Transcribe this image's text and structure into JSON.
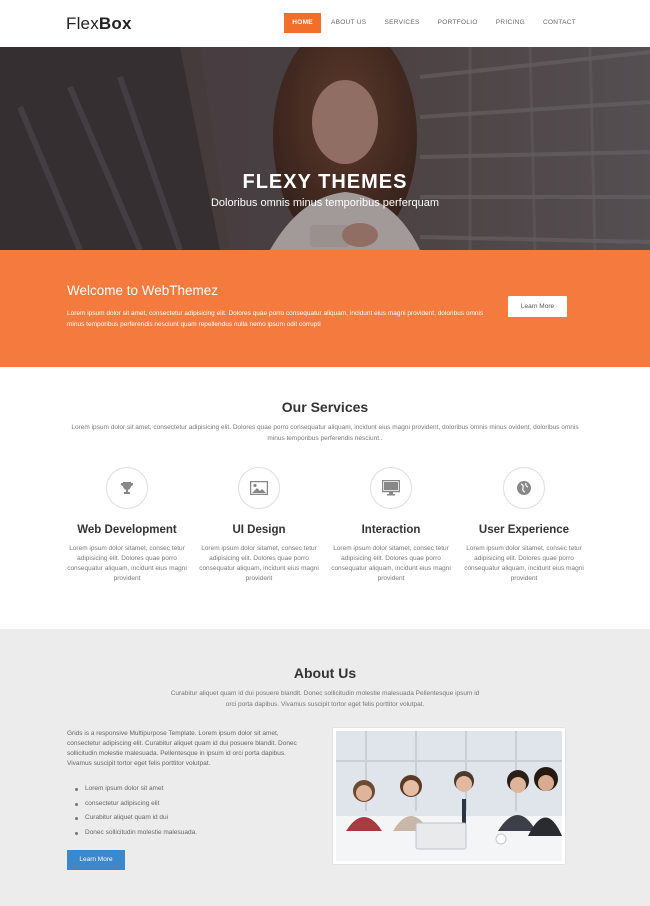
{
  "brand": {
    "light": "Flex",
    "bold": "Box"
  },
  "nav": [
    "HOME",
    "ABOUT US",
    "SERVICES",
    "PORTFOLIO",
    "PRICING",
    "CONTACT"
  ],
  "hero": {
    "title": "FLEXY THEMES",
    "subtitle": "Doloribus omnis minus temporibus perferquam"
  },
  "welcome": {
    "title": "Welcome to WebThemez",
    "text": "Lorem ipsum dolor sit amet, consectetur adipisicing elit. Dolores quae porro consequatur aliquam, incidunt eius magni provident, doloribus omnis minus temporibus perferendis nesciunt quam repellendus nulla nemo ipsum odit corrupti",
    "button": "Learn More"
  },
  "services": {
    "title": "Our Services",
    "desc": "Lorem ipsum dolor sit amet, consectetur adipisicing elit. Dolores quae porro consequatur aliquam, incidunt eius magni provident, doloribus omnis minus ovident, doloribus omnis minus temporibus perferendis nesciunt..",
    "items": [
      {
        "icon": "trophy-icon",
        "title": "Web Development",
        "text": "Lorem ipsum dolor sitamet, consec tetur adipisicing elit. Dolores quae porro consequatur aliquam, incidunt eius magni provident"
      },
      {
        "icon": "image-icon",
        "title": "UI Design",
        "text": "Lorem ipsum dolor sitamet, consec tetur adipisicing elit. Dolores quae porro consequatur aliquam, incidunt eius magni provident"
      },
      {
        "icon": "monitor-icon",
        "title": "Interaction",
        "text": "Lorem ipsum dolor sitamet, consec tetur adipisicing elit. Dolores quae porro consequatur aliquam, incidunt eius magni provident"
      },
      {
        "icon": "globe-icon",
        "title": "User Experience",
        "text": "Lorem ipsum dolor sitamet, consec tetur adipisicing elit. Dolores quae porro consequatur aliquam, incidunt eius magni provident"
      }
    ]
  },
  "about": {
    "title": "About Us",
    "desc": "Curabitur aliquet quam id dui posuere blandit. Donec sollicitudin molestie malesuada Pellentesque ipsum id orci porta dapibus. Vivamus suscipit tortor eget felis porttitor volutpat.",
    "body": "Grids is a responsive Multipurpose Template. Lorem ipsum dolor sit amet, consectetur adipiscing elit. Curabitur aliquet quam id dui posuere blandit. Donec sollicitudin molestie malesuada. Pellentesque in ipsum id orci porta dapibus. Vivamus suscipit tortor eget felis porttitor volutpat.",
    "list": [
      "Lorem ipsum dolor sit amet",
      "consectetur adipiscing elit",
      "Curabitur aliquet quam id dui",
      "Donec sollicitudin molestie malesuada."
    ],
    "button": "Learn More"
  },
  "colors": {
    "accent": "#f47a3d",
    "active_nav": "#f26f2b",
    "button_blue": "#3d87cb",
    "about_bg": "#ececec"
  }
}
